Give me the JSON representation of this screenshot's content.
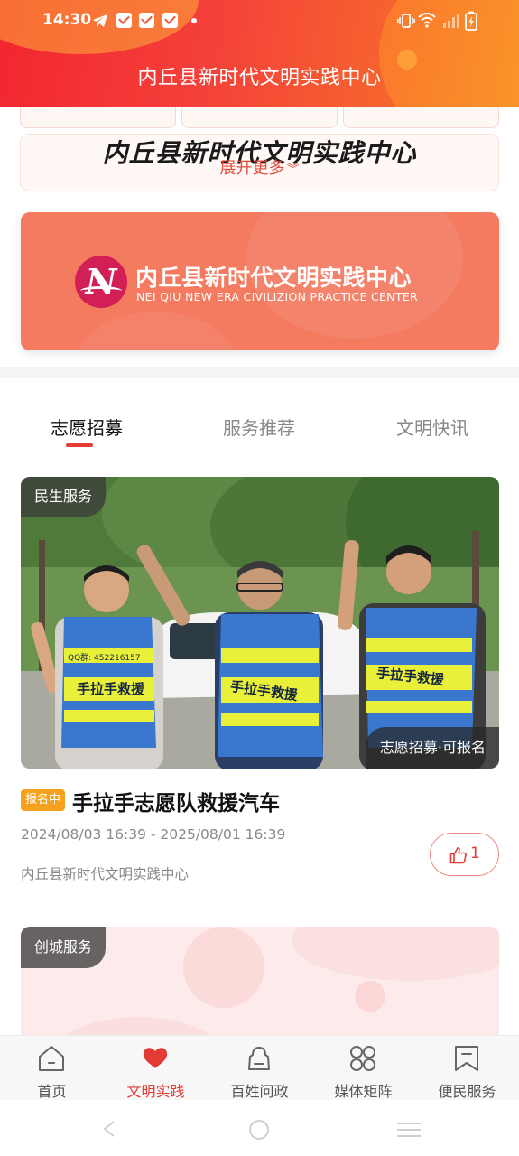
{
  "status_bar": {
    "time": "14:30"
  },
  "header": {
    "title": "内丘县新时代文明实践中心"
  },
  "top": {
    "brand_text": "内丘县新时代文明实践中心",
    "expand_label": "展开更多"
  },
  "banner": {
    "title": "内丘县新时代文明实践中心",
    "subtitle": "NEI QIU NEW ERA CIVILIZION PRACTICE CENTER"
  },
  "tabs": [
    {
      "label": "志愿招募",
      "active": true
    },
    {
      "label": "服务推荐",
      "active": false
    },
    {
      "label": "文明快讯",
      "active": false
    }
  ],
  "cards": [
    {
      "category": "民生服务",
      "status_overlay": "志愿招募·可报名",
      "badge": "报名中",
      "title": "手拉手志愿队救援汽车",
      "date_range": "2024/08/03 16:39 - 2025/08/01 16:39",
      "org": "内丘县新时代文明实践中心",
      "likes": "1",
      "vest_text": "手拉手救援",
      "qq_text": "QQ群: 452216157"
    },
    {
      "category": "创城服务"
    }
  ],
  "bottom_nav": [
    {
      "label": "首页",
      "icon": "home-icon",
      "active": false
    },
    {
      "label": "文明实践",
      "icon": "heart-hands-icon",
      "active": true
    },
    {
      "label": "百姓问政",
      "icon": "people-icon",
      "active": false
    },
    {
      "label": "媒体矩阵",
      "icon": "grid-icon",
      "active": false
    },
    {
      "label": "便民服务",
      "icon": "bookmark-icon",
      "active": false
    }
  ],
  "colors": {
    "accent": "#e23b36",
    "header_start": "#f2262f",
    "header_end": "#f7892a",
    "banner": "#f47a60",
    "badge": "#f6a11b"
  }
}
